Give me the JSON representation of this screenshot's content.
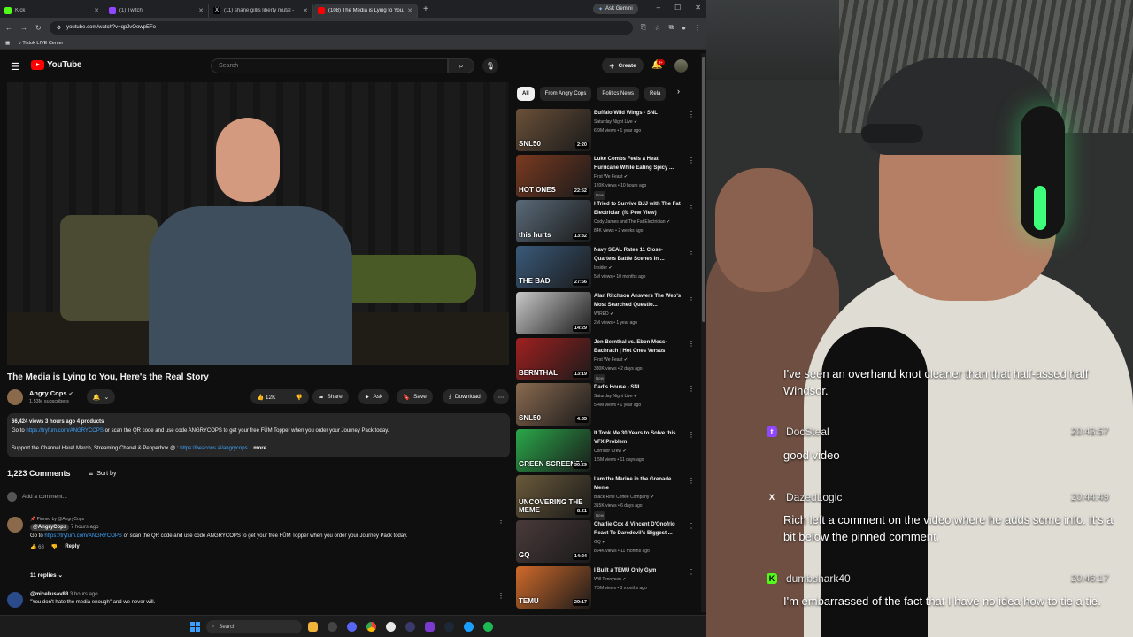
{
  "browser": {
    "tabs": [
      {
        "title": "Kick",
        "active": false
      },
      {
        "title": "(1) Twitch",
        "active": false
      },
      {
        "title": "(11) shane gillis liberty mutal -",
        "active": false
      },
      {
        "title": "(108) The Media is Lying to You,",
        "active": true
      }
    ],
    "ask_gemini": "Ask Gemini",
    "url": "youtube.com/watch?v=qpJvOowpEFo",
    "bookmark": "Tiktok LIVE Center"
  },
  "youtube": {
    "logo_text": "YouTube",
    "search_placeholder": "Search",
    "create_label": "Create",
    "notif_badge": "9+",
    "video_title": "The Media is Lying to You, Here's the Real Story",
    "channel_name": "Angry Cops",
    "subscribers": "1.53M subscribers",
    "likes": "12K",
    "share": "Share",
    "ask": "Ask",
    "save": "Save",
    "download": "Download",
    "description": {
      "stats": "66,424 views  3 hours ago  4 products",
      "line1_pre": "Go to ",
      "line1_link": "https://tryfum.com/ANGRYCOPS",
      "line1_post": " or scan the QR code and use code ANGRYCOPS to get your free FŪM Topper when you order your Journey Pack today.",
      "line2_pre": "Support the Channel Here! Merch, Streaming Chanel & Pepperbox @ : ",
      "line2_link": "https://beacons.ai/angrycops",
      "more": "...more"
    },
    "comments_count": "1,223 Comments",
    "sort_by": "Sort by",
    "add_comment": "Add a comment...",
    "pinned": {
      "pinned_by": "Pinned by @AngryCops",
      "author": "@AngryCops",
      "time": "7 hours ago",
      "text_pre": "Go to ",
      "text_link": "https://tryfum.com/ANGRYCOPS",
      "text_post": " or scan the QR code and use code ANGRYCOPS to get your free FŪM Topper when you order your Journey Pack today.",
      "likes": "68",
      "reply": "Reply",
      "replies": "11 replies"
    },
    "comment2": {
      "author": "@micellusav88",
      "time": "3 hours ago",
      "text": "\"You don't hate the media enough\" and we never will."
    },
    "chips": [
      "All",
      "From Angry Cops",
      "Politics News",
      "Rela"
    ],
    "recommendations": [
      {
        "title": "Buffalo Wild Wings - SNL",
        "channel": "Saturday Night Live",
        "views": "6.9M views • 1 year ago",
        "duration": "2:20",
        "new": "",
        "thumb": "#6a5038",
        "overlay": "SNL50"
      },
      {
        "title": "Luke Combs Feels a Heat Hurricane While Eating Spicy ...",
        "channel": "First We Feast",
        "views": "120K views • 10 hours ago",
        "duration": "22:52",
        "new": "New",
        "thumb": "#7a3a20",
        "overlay": "HOT ONES"
      },
      {
        "title": "I Tried to Survive BJJ with The Fat Electrician (ft. Pew View)",
        "channel": "Cody James and The Fat Electrician",
        "views": "84K views • 2 weeks ago",
        "duration": "13:32",
        "new": "",
        "thumb": "#5a6a78",
        "overlay": "this hurts"
      },
      {
        "title": "Navy SEAL Rates 11 Close-Quarters Battle Scenes In ...",
        "channel": "Insider",
        "views": "5M views • 10 months ago",
        "duration": "27:56",
        "new": "",
        "thumb": "#3a5a7a",
        "overlay": "THE BAD"
      },
      {
        "title": "Alan Ritchson Answers The Web's Most Searched Questio...",
        "channel": "WIRED",
        "views": "2M views • 1 year ago",
        "duration": "14:29",
        "new": "",
        "thumb": "#c8c8c8",
        "overlay": ""
      },
      {
        "title": "Jon Bernthal vs. Ebon Moss-Bachrach | Hot Ones Versus",
        "channel": "First We Feast",
        "views": "330K views • 2 days ago",
        "duration": "13:19",
        "new": "New",
        "thumb": "#a02020",
        "overlay": "BERNTHAL"
      },
      {
        "title": "Dad's House - SNL",
        "channel": "Saturday Night Live",
        "views": "5.4M views • 1 year ago",
        "duration": "4:35",
        "new": "",
        "thumb": "#8a6a50",
        "overlay": "SNL50"
      },
      {
        "title": "It Took Me 30 Years to Solve this VFX Problem",
        "channel": "Corridor Crew",
        "views": "1.5M views • 11 days ago",
        "duration": "30:29",
        "new": "",
        "thumb": "#2aa84a",
        "overlay": "GREEN SCREENS!"
      },
      {
        "title": "I am the Marine in the Grenade Meme",
        "channel": "Black Rifle Coffee Company",
        "views": "315K views • 6 days ago",
        "duration": "8:21",
        "new": "New",
        "thumb": "#6a5a3a",
        "overlay": "UNCOVERING THE MEME"
      },
      {
        "title": "Charlie Cox & Vincent D'Onofrio React To Daredevil's Biggest ...",
        "channel": "GQ",
        "views": "864K views • 11 months ago",
        "duration": "14:24",
        "new": "",
        "thumb": "#4a3a3a",
        "overlay": "GQ"
      },
      {
        "title": "I Built a TEMU Only Gym",
        "channel": "Will Tennyson",
        "views": "7.5M views • 3 months ago",
        "duration": "29:17",
        "new": "",
        "thumb": "#d06a2a",
        "overlay": "TEMU"
      }
    ]
  },
  "taskbar": {
    "search": "Search"
  },
  "stream_chat": {
    "first_message": "I've seen an overhand knot cleaner than that half-assed half Windsor.",
    "messages": [
      {
        "platform": "twitch",
        "user": "DocSteal",
        "time": "20:43:57",
        "text": "good video"
      },
      {
        "platform": "x",
        "user": "DazedLogic",
        "time": "20:44:49",
        "text": "Rich left a comment on the video where he adds some info. It's a bit below the pinned comment."
      },
      {
        "platform": "kick",
        "user": "dumbshark40",
        "time": "20:46:17",
        "text": "I'm embarrassed of the fact that I have no idea how to tie a tie."
      }
    ]
  }
}
